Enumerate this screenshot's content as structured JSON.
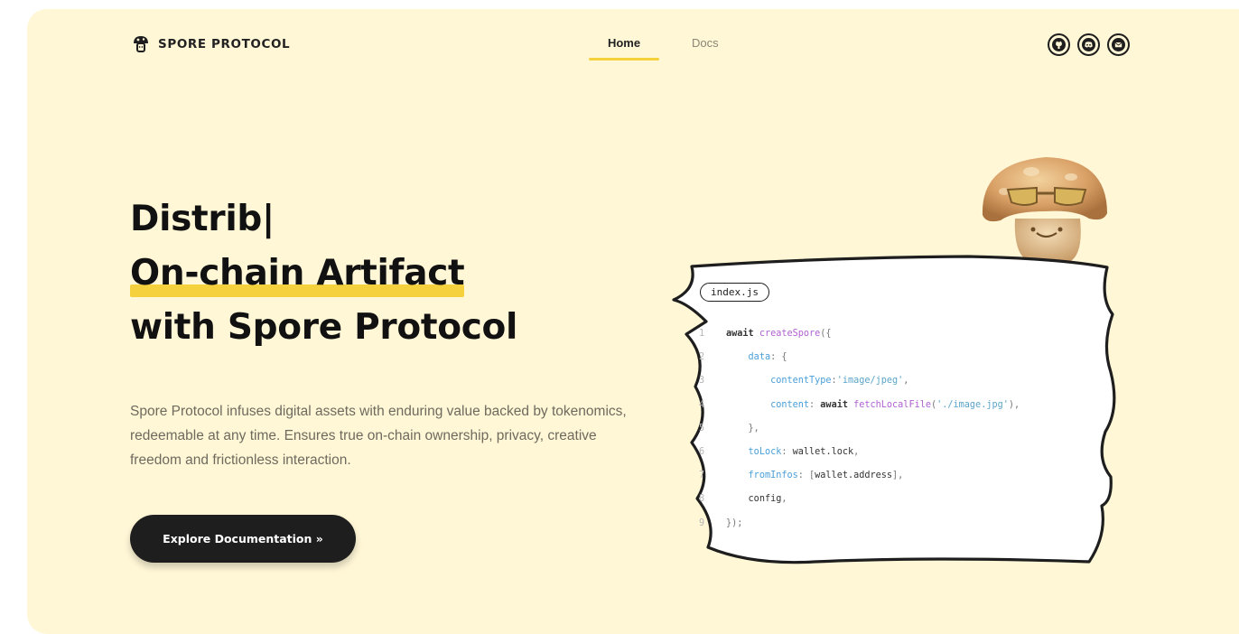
{
  "brand": {
    "name": "SPORE PROTOCOL",
    "icon": "mushroom-logo-icon"
  },
  "nav": {
    "items": [
      {
        "label": "Home",
        "active": true
      },
      {
        "label": "Docs",
        "active": false
      }
    ]
  },
  "social": [
    {
      "icon": "github-icon"
    },
    {
      "icon": "discord-icon"
    },
    {
      "icon": "mail-icon"
    }
  ],
  "hero": {
    "line1": "Distrib|",
    "line2": "On-chain Artifact",
    "line3": "with Spore Protocol",
    "description": "Spore Protocol infuses digital assets with enduring value backed by tokenomics, redeemable at any time. Ensures true on-chain ownership, privacy, creative freedom and frictionless interaction.",
    "cta_label": "Explore Documentation »"
  },
  "code_card": {
    "file_name": "index.js",
    "lines": [
      {
        "num": "1",
        "indent": "",
        "tokens": [
          {
            "t": "await ",
            "c": "kw"
          },
          {
            "t": "createSpore",
            "c": "fn"
          },
          {
            "t": "({",
            "c": "punc"
          }
        ]
      },
      {
        "num": "2",
        "indent": "    ",
        "tokens": [
          {
            "t": "data",
            "c": "prop"
          },
          {
            "t": ": {",
            "c": "punc"
          }
        ]
      },
      {
        "num": "3",
        "indent": "        ",
        "tokens": [
          {
            "t": "contentType",
            "c": "prop"
          },
          {
            "t": ":",
            "c": "punc"
          },
          {
            "t": "'image/jpeg'",
            "c": "str"
          },
          {
            "t": ",",
            "c": "punc"
          }
        ]
      },
      {
        "num": "4",
        "indent": "        ",
        "tokens": [
          {
            "t": "content",
            "c": "prop"
          },
          {
            "t": ": ",
            "c": "punc"
          },
          {
            "t": "await ",
            "c": "kw"
          },
          {
            "t": "fetchLocalFile",
            "c": "fn"
          },
          {
            "t": "(",
            "c": "punc"
          },
          {
            "t": "'./image.jpg'",
            "c": "str"
          },
          {
            "t": "),",
            "c": "punc"
          }
        ]
      },
      {
        "num": "5",
        "indent": "    ",
        "tokens": [
          {
            "t": "},",
            "c": "punc"
          }
        ]
      },
      {
        "num": "6",
        "indent": "    ",
        "tokens": [
          {
            "t": "toLock",
            "c": "prop"
          },
          {
            "t": ": ",
            "c": "punc"
          },
          {
            "t": "wallet.lock",
            "c": "plain"
          },
          {
            "t": ",",
            "c": "punc"
          }
        ]
      },
      {
        "num": "7",
        "indent": "    ",
        "tokens": [
          {
            "t": "fromInfos",
            "c": "prop"
          },
          {
            "t": ": [",
            "c": "punc"
          },
          {
            "t": "wallet.address",
            "c": "plain"
          },
          {
            "t": "],",
            "c": "punc"
          }
        ]
      },
      {
        "num": "8",
        "indent": "    ",
        "tokens": [
          {
            "t": "config",
            "c": "plain"
          },
          {
            "t": ",",
            "c": "punc"
          }
        ]
      },
      {
        "num": "9",
        "indent": "",
        "tokens": [
          {
            "t": "});",
            "c": "punc"
          }
        ]
      }
    ]
  },
  "mascot": {
    "icon": "mushroom-mascot-with-sunglasses-icon"
  },
  "colors": {
    "background": "#fff7d6",
    "accent": "#f5d23d",
    "dark": "#1e1e1e"
  }
}
